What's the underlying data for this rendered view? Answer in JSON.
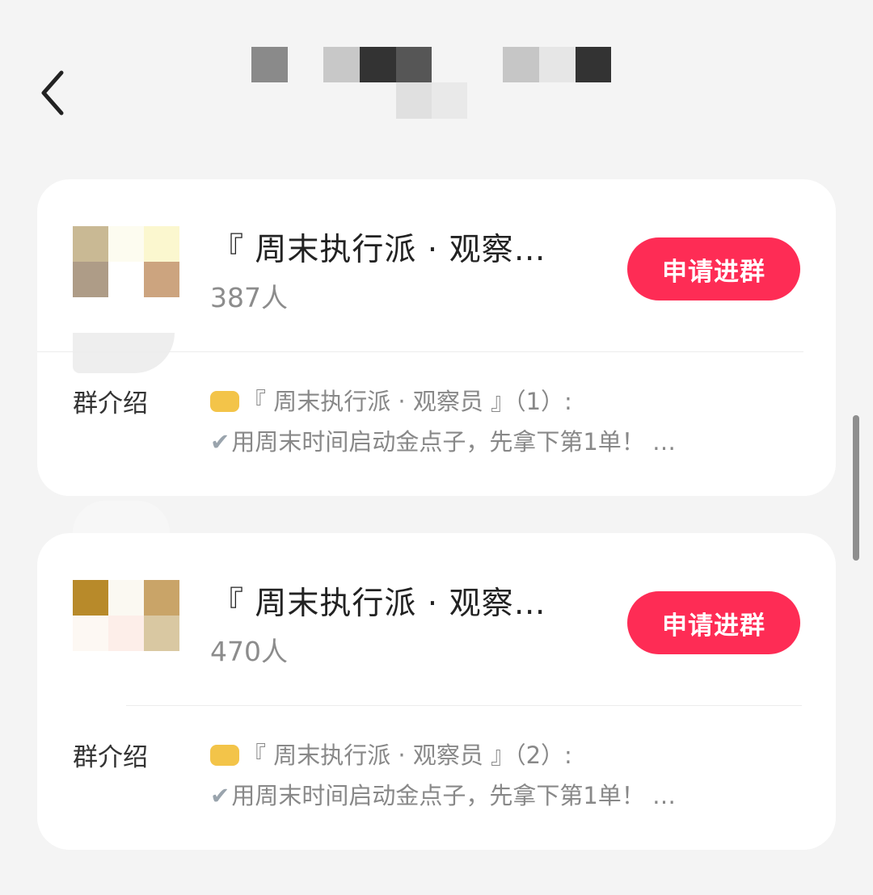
{
  "colors": {
    "accent": "#fe2c55",
    "background": "#f4f4f4",
    "card": "#ffffff"
  },
  "header": {
    "back_icon": "chevron-left-icon"
  },
  "groups": [
    {
      "name": "『 周末执行派 · 观察…",
      "member_count": "387人",
      "join_label": "申请进群",
      "intro_label": "群介绍",
      "intro_line1": "『 周末执行派 · 观察员 』（1）:",
      "intro_line2": "用周末时间启动金点子，先拿下第1单！ …",
      "intro_icon1": "fist-emoji-icon",
      "intro_icon2": "check-mark-icon"
    },
    {
      "name": "『 周末执行派 · 观察…",
      "member_count": "470人",
      "join_label": "申请进群",
      "intro_label": "群介绍",
      "intro_line1": "『 周末执行派 · 观察员 』（2）:",
      "intro_line2": "用周末时间启动金点子，先拿下第1单！ …",
      "intro_icon1": "fist-emoji-icon",
      "intro_icon2": "check-mark-icon"
    }
  ]
}
